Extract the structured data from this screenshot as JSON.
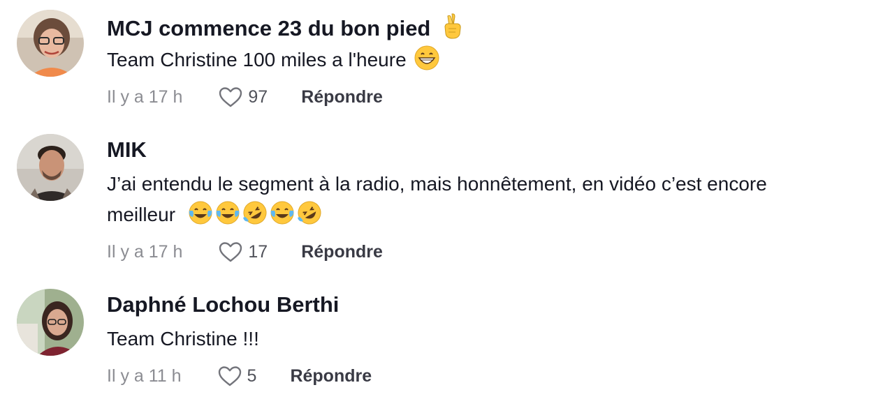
{
  "comments": [
    {
      "author": "MCJ commence 23 du bon pied",
      "author_emoji": "crossed-fingers",
      "text": "Team Christine 100 miles a l'heure",
      "text_emojis": [
        "grinning-face"
      ],
      "time": "Il y a 17 h",
      "likes": "97",
      "reply_label": "Répondre"
    },
    {
      "author": "MIK",
      "text_line1": "J’ai entendu le segment à la radio, mais honnêtement, en vidéo c’est encore",
      "text_line2": "meilleur",
      "text_emojis": [
        "tears-of-joy",
        "tears-of-joy",
        "rolling-laughing",
        "tears-of-joy",
        "rolling-laughing"
      ],
      "time": "Il y a 17 h",
      "likes": "17",
      "reply_label": "Répondre"
    },
    {
      "author": "Daphné Lochou Berthi",
      "text": "Team Christine !!!",
      "time": "Il y a 11 h",
      "likes": "5",
      "reply_label": "Répondre"
    }
  ],
  "colors": {
    "text_primary": "#161823",
    "text_muted": "rgba(22,24,35,0.5)",
    "emoji_yellow": "#FFC83D"
  }
}
